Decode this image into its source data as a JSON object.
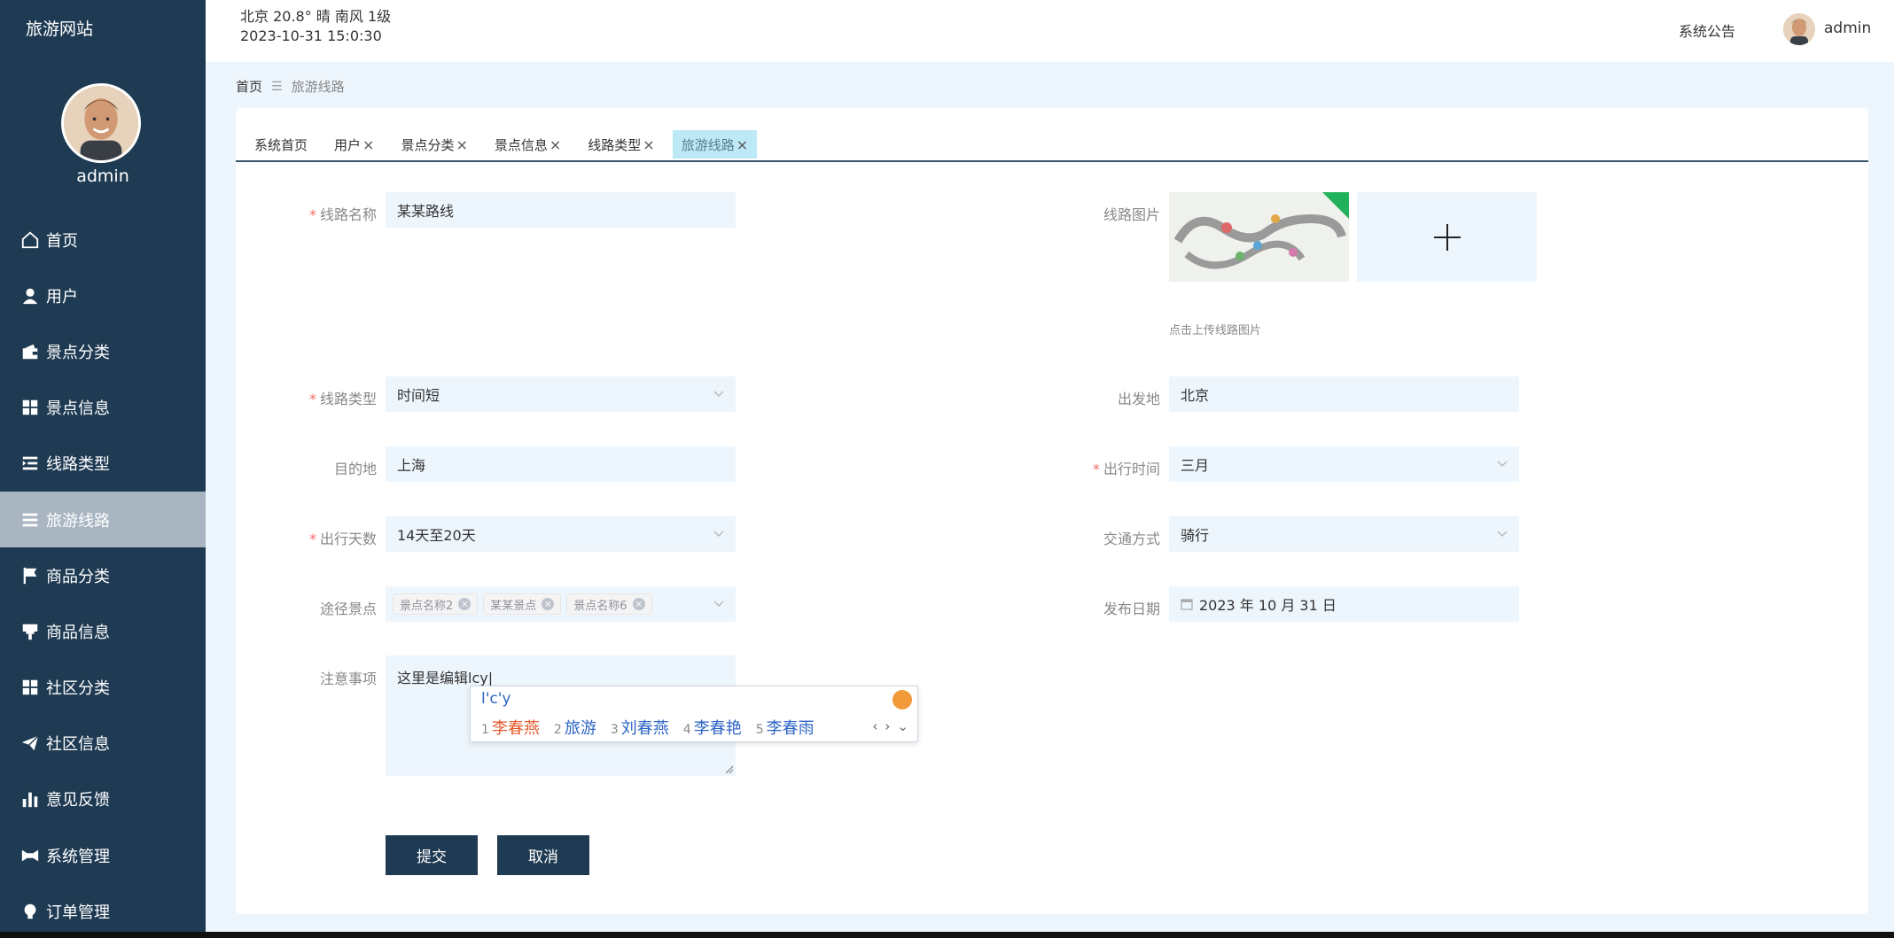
{
  "app": {
    "brand": "旅游网站"
  },
  "sidebar": {
    "username": "admin",
    "items": [
      {
        "label": "首页",
        "icon": "home-icon"
      },
      {
        "label": "用户",
        "icon": "user-icon"
      },
      {
        "label": "景点分类",
        "icon": "wallet-icon"
      },
      {
        "label": "景点信息",
        "icon": "grid-icon"
      },
      {
        "label": "线路类型",
        "icon": "list-indent-icon"
      },
      {
        "label": "旅游线路",
        "icon": "list-icon",
        "active": true
      },
      {
        "label": "商品分类",
        "icon": "flag-icon"
      },
      {
        "label": "商品信息",
        "icon": "stamp-icon"
      },
      {
        "label": "社区分类",
        "icon": "grid-icon"
      },
      {
        "label": "社区信息",
        "icon": "send-icon"
      },
      {
        "label": "意见反馈",
        "icon": "bar-chart-icon"
      },
      {
        "label": "系统管理",
        "icon": "bowtie-icon"
      },
      {
        "label": "订单管理",
        "icon": "bulb-icon"
      }
    ]
  },
  "topbar": {
    "weather": "北京  20.8°  晴  南风  1级",
    "datetime": "2023-10-31 15:0:30",
    "notice": "系统公告",
    "username": "admin"
  },
  "breadcrumb": {
    "home": "首页",
    "current": "旅游线路"
  },
  "tabs": [
    {
      "label": "系统首页",
      "closable": false
    },
    {
      "label": "用户",
      "closable": true
    },
    {
      "label": "景点分类",
      "closable": true
    },
    {
      "label": "景点信息",
      "closable": true
    },
    {
      "label": "线路类型",
      "closable": true
    },
    {
      "label": "旅游线路",
      "closable": true,
      "active": true
    }
  ],
  "form": {
    "route_name": {
      "label": "线路名称",
      "value": "某某路线",
      "required": true
    },
    "route_image": {
      "label": "线路图片",
      "tip": "点击上传线路图片"
    },
    "route_type": {
      "label": "线路类型",
      "value": "时间短",
      "required": true
    },
    "departure": {
      "label": "出发地",
      "value": "北京"
    },
    "destination": {
      "label": "目的地",
      "value": "上海"
    },
    "travel_time": {
      "label": "出行时间",
      "value": "三月",
      "required": true
    },
    "travel_days": {
      "label": "出行天数",
      "value": "14天至20天",
      "required": true
    },
    "transport": {
      "label": "交通方式",
      "value": "骑行"
    },
    "via_spots": {
      "label": "途径景点",
      "tags": [
        "景点名称2",
        "某某景点",
        "景点名称6"
      ]
    },
    "publish_date": {
      "label": "发布日期",
      "value": "2023 年 10 月 31 日"
    },
    "notes": {
      "label": "注意事项",
      "value": "这里是编辑lcy"
    },
    "submit": "提交",
    "cancel": "取消"
  },
  "ime": {
    "composition": "l'c'y",
    "candidates": [
      {
        "n": "1",
        "text": "李春燕"
      },
      {
        "n": "2",
        "text": "旅游"
      },
      {
        "n": "3",
        "text": "刘春燕"
      },
      {
        "n": "4",
        "text": "李春艳"
      },
      {
        "n": "5",
        "text": "李春雨"
      }
    ],
    "nav_prev": "‹",
    "nav_next": "›",
    "nav_expand": "⌄"
  },
  "colors": {
    "sidebar": "#1f3b53",
    "accent": "#1f3b53",
    "active_tab": "#bde8f5",
    "required": "#f56c6c"
  }
}
